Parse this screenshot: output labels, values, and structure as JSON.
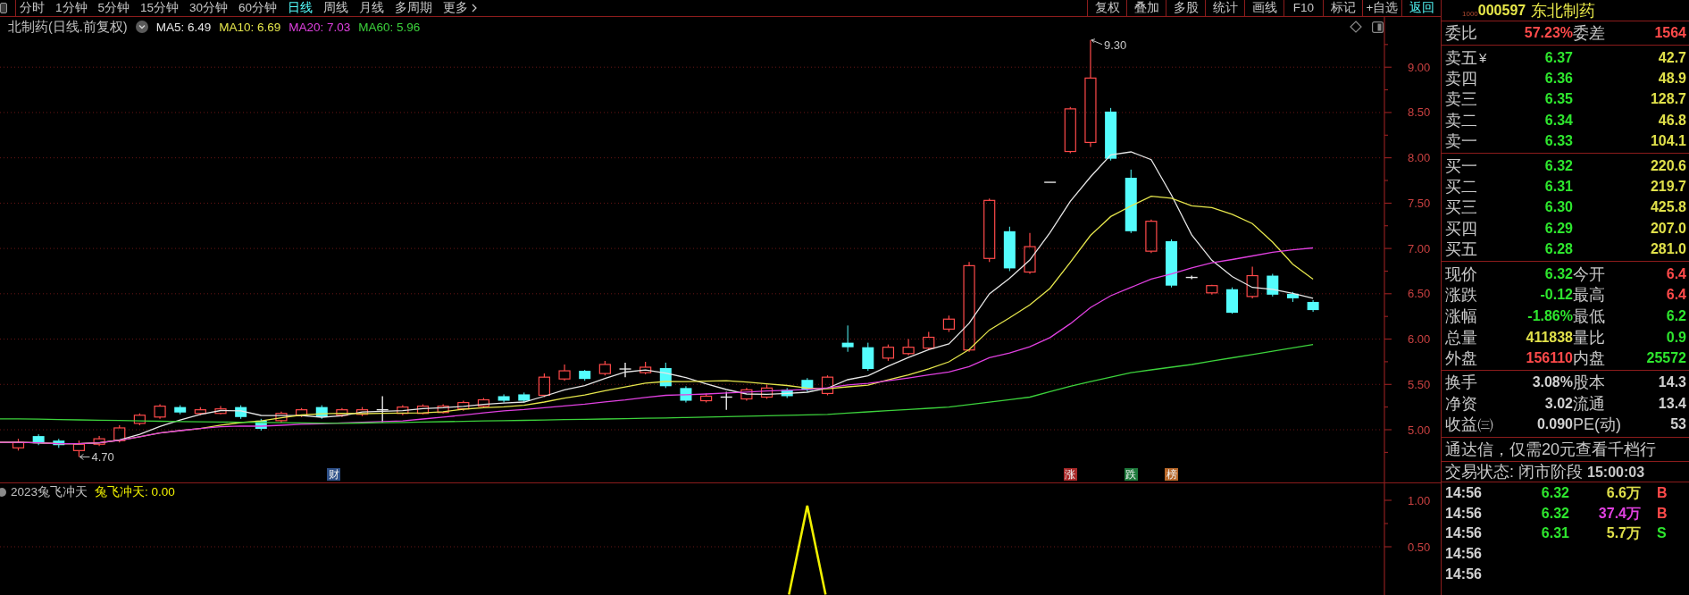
{
  "toolbar": {
    "periods": [
      {
        "label": "分时",
        "selected": false
      },
      {
        "label": "1分钟",
        "selected": false
      },
      {
        "label": "5分钟",
        "selected": false
      },
      {
        "label": "15分钟",
        "selected": false
      },
      {
        "label": "30分钟",
        "selected": false
      },
      {
        "label": "60分钟",
        "selected": false
      },
      {
        "label": "日线",
        "selected": true
      },
      {
        "label": "周线",
        "selected": false
      },
      {
        "label": "月线",
        "selected": false
      },
      {
        "label": "多周期",
        "selected": false
      }
    ],
    "more": "更多",
    "actions": [
      {
        "label": "复权",
        "kind": "tool"
      },
      {
        "label": "叠加",
        "kind": "tool"
      },
      {
        "label": "多股",
        "kind": "tool"
      },
      {
        "label": "统计",
        "kind": "tool"
      },
      {
        "label": "画线",
        "kind": "tool"
      },
      {
        "label": "F10",
        "kind": "tool"
      },
      {
        "label": "标记",
        "kind": "tool"
      },
      {
        "label": "+自选",
        "kind": "tool"
      },
      {
        "label": "返回",
        "kind": "back"
      }
    ]
  },
  "price_chart": {
    "title": "北制药(日线.前复权)",
    "indicators": [
      {
        "label": "MA5: 6.49",
        "color": "#e6e6e6"
      },
      {
        "label": "MA10: 6.69",
        "color": "#e6e64c"
      },
      {
        "label": "MA20: 7.03",
        "color": "#e040e0"
      },
      {
        "label": "MA60: 5.96",
        "color": "#3cd23c"
      }
    ],
    "axis_labels": [
      "9.00",
      "8.50",
      "8.00",
      "7.50",
      "7.00",
      "6.50",
      "6.00",
      "5.50",
      "5.00"
    ],
    "high_label": "9.30",
    "low_label": "4.70",
    "events": [
      {
        "label": "财",
        "color": "#2e5088"
      },
      {
        "label": "涨",
        "color": "#a82828"
      },
      {
        "label": "跌",
        "color": "#1e7a3c"
      },
      {
        "label": "榜",
        "color": "#b8682a"
      }
    ]
  },
  "indicator_chart": {
    "name": "2023兔飞冲天",
    "value_label": "兔飞冲天: 0.00",
    "axis_labels": [
      "1.00",
      "0.50"
    ]
  },
  "quote_panel": {
    "tag": "1000",
    "code": "000597",
    "name": "东北制药",
    "ratio": {
      "label": "委比",
      "value": {
        "text": "57.23%",
        "color": "#ff4a4a"
      },
      "label2": "委差",
      "value2": {
        "text": "1564",
        "color": "#ff4a4a"
      }
    },
    "asks": [
      {
        "label": "卖五",
        "mark": "¥",
        "price": "6.37",
        "volume": "42.7"
      },
      {
        "label": "卖四",
        "price": "6.36",
        "volume": "48.9"
      },
      {
        "label": "卖三",
        "price": "6.35",
        "volume": "128.7"
      },
      {
        "label": "卖二",
        "price": "6.34",
        "volume": "46.8"
      },
      {
        "label": "卖一",
        "price": "6.33",
        "volume": "104.1"
      }
    ],
    "bids": [
      {
        "label": "买一",
        "price": "6.32",
        "volume": "220.6"
      },
      {
        "label": "买二",
        "price": "6.31",
        "volume": "219.7"
      },
      {
        "label": "买三",
        "price": "6.30",
        "volume": "425.8"
      },
      {
        "label": "买四",
        "price": "6.29",
        "volume": "207.0"
      },
      {
        "label": "买五",
        "price": "6.28",
        "volume": "281.0"
      }
    ],
    "stats": [
      {
        "label": "现价",
        "value": {
          "text": "6.32",
          "color": "#2ee62e"
        },
        "label2": "今开",
        "value2": {
          "text": "6.4",
          "color": "#ff4a4a"
        }
      },
      {
        "label": "涨跌",
        "value": {
          "text": "-0.12",
          "color": "#2ee62e"
        },
        "label2": "最高",
        "value2": {
          "text": "6.4",
          "color": "#ff4a4a"
        }
      },
      {
        "label": "涨幅",
        "value": {
          "text": "-1.86%",
          "color": "#2ee62e"
        },
        "label2": "最低",
        "value2": {
          "text": "6.2",
          "color": "#2ee62e"
        }
      },
      {
        "label": "总量",
        "value": {
          "text": "411838",
          "color": "#e0e04a"
        },
        "label2": "量比",
        "value2": {
          "text": "0.9",
          "color": "#2ee62e"
        }
      },
      {
        "label": "外盘",
        "value": {
          "text": "156110",
          "color": "#ff4a4a"
        },
        "label2": "内盘",
        "value2": {
          "text": "25572",
          "color": "#2ee62e"
        }
      }
    ],
    "fundamentals": [
      {
        "label": "换手",
        "value": "3.08%",
        "label2": "股本",
        "value2": "14.3"
      },
      {
        "label": "净资",
        "value": "3.02",
        "label2": "流通",
        "value2": "13.4"
      },
      {
        "label": "收益㈢",
        "value": "0.090",
        "label2": "PE(动)",
        "value2": "53"
      }
    ],
    "notice": "通达信，仅需20元查看千档行",
    "status": "交易状态: 闭市阶段 **15:00:03**",
    "ticks": [
      {
        "time": "14:56",
        "price": "6.32",
        "volume": "6.6万",
        "large": false,
        "side": {
          "text": "B",
          "color": "#ff4a4a"
        }
      },
      {
        "time": "14:56",
        "price": "6.32",
        "volume": "37.4万",
        "large": true,
        "side": {
          "text": "B",
          "color": "#ff4a4a"
        }
      },
      {
        "time": "14:56",
        "price": "6.31",
        "volume": "5.7万",
        "large": false,
        "side": {
          "text": "S",
          "color": "#2ee62e"
        }
      },
      {
        "time": "14:56"
      },
      {
        "time": "14:56"
      }
    ]
  }
}
